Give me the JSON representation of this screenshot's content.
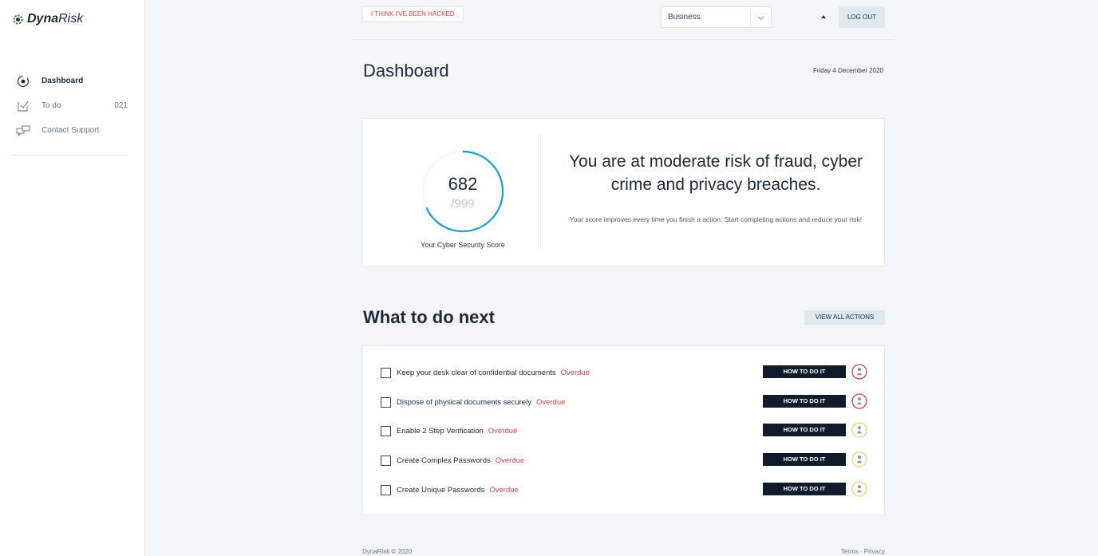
{
  "brand": {
    "bold": "Dyna",
    "light": "Risk",
    "color": "#3a8a2e"
  },
  "sidebar": {
    "items": [
      {
        "label": "Dashboard",
        "icon": "target-icon",
        "active": true,
        "count": ""
      },
      {
        "label": "To do",
        "icon": "checklist-icon",
        "active": false,
        "count": "021"
      },
      {
        "label": "Contact Support",
        "icon": "chat-icon",
        "active": false,
        "count": ""
      }
    ]
  },
  "topbar": {
    "hacked_label": "I THINK I'VE BEEN HACKED",
    "account_select": "Business",
    "logout_label": "LOG OUT"
  },
  "page": {
    "title": "Dashboard",
    "date": "Friday 4 December 2020"
  },
  "score": {
    "value": "682",
    "max": "/999",
    "fraction": 0.682,
    "label": "Your Cyber Security Score",
    "ring_color": "#1a9fd0"
  },
  "risk": {
    "message": "You are at moderate risk of fraud, cyber crime and privacy breaches.",
    "sub": "Your score improves every time you finish a action. Start completing actions and reduce your risk!"
  },
  "next": {
    "title": "What to do next",
    "view_all_label": "VIEW ALL ACTIONS",
    "how_label": "HOW TO DO IT",
    "actions": [
      {
        "label": "Keep your desk clear of confidential documents",
        "status": "Overdue",
        "avatar_color": "#d64545"
      },
      {
        "label": "Dispose of physical documents securely",
        "status": "Overdue",
        "avatar_color": "#d64545"
      },
      {
        "label": "Enable 2 Step Verification",
        "status": "Overdue",
        "avatar_color": "#f0d27a"
      },
      {
        "label": "Create Complex Passwords",
        "status": "Overdue",
        "avatar_color": "#f0d27a"
      },
      {
        "label": "Create Unique Passwords",
        "status": "Overdue",
        "avatar_color": "#f0d27a"
      }
    ]
  },
  "footer": {
    "copyright": "DynaRisk © 2020",
    "terms": "Terms",
    "privacy": "Privacy"
  }
}
